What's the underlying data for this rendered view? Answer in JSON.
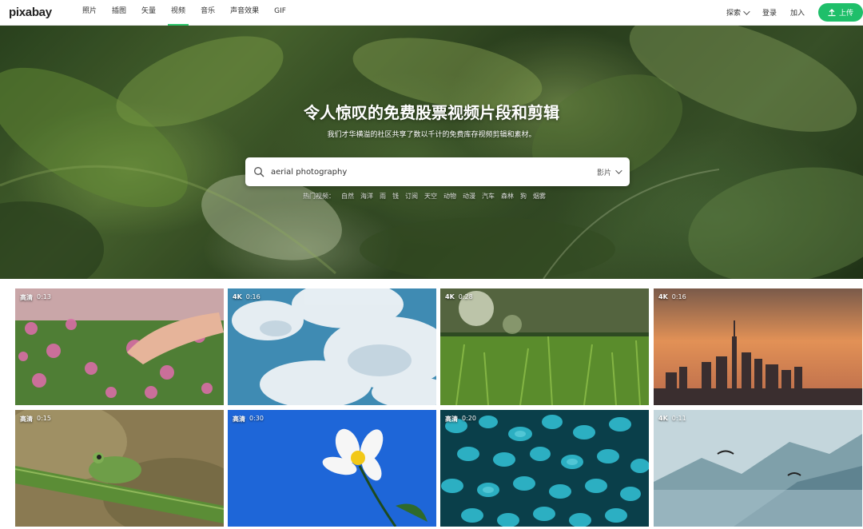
{
  "nav": {
    "logo": "pixabay",
    "links": [
      "照片",
      "插图",
      "矢量",
      "视频",
      "音乐",
      "声音效果",
      "GIF"
    ],
    "active_index": 3,
    "explore": "探索",
    "login": "登录",
    "join": "加入",
    "upload": "上传"
  },
  "hero": {
    "title": "令人惊叹的免费股票视频片段和剪辑",
    "subtitle": "我们才华横溢的社区共享了数以千计的免费库存视频剪辑和素材。",
    "search_value": "aerial photography",
    "search_type": "影片",
    "trending_label": "热门视频：",
    "trending": [
      "自然",
      "海洋",
      "雨",
      "钱",
      "订阅",
      "天空",
      "动物",
      "动漫",
      "汽车",
      "森林",
      "狗",
      "烟雾"
    ]
  },
  "videos": [
    {
      "quality": "高清",
      "duration": "0:13",
      "scene": "pink-flowers-hand"
    },
    {
      "quality": "4K",
      "duration": "0:16",
      "scene": "clouds-sky"
    },
    {
      "quality": "4K",
      "duration": "0:28",
      "scene": "grass-dew"
    },
    {
      "quality": "4K",
      "duration": "0:16",
      "scene": "city-skyline-sunset"
    },
    {
      "quality": "高清",
      "duration": "0:15",
      "scene": "frog-bamboo"
    },
    {
      "quality": "高清",
      "duration": "0:30",
      "scene": "white-flower-blue-sky"
    },
    {
      "quality": "高清",
      "duration": "0:20",
      "scene": "blue-leaves"
    },
    {
      "quality": "4K",
      "duration": "0:11",
      "scene": "paragliders-mountain-lake"
    }
  ],
  "colors": {
    "accent": "#1fbf6a",
    "nav_text": "#333333"
  }
}
